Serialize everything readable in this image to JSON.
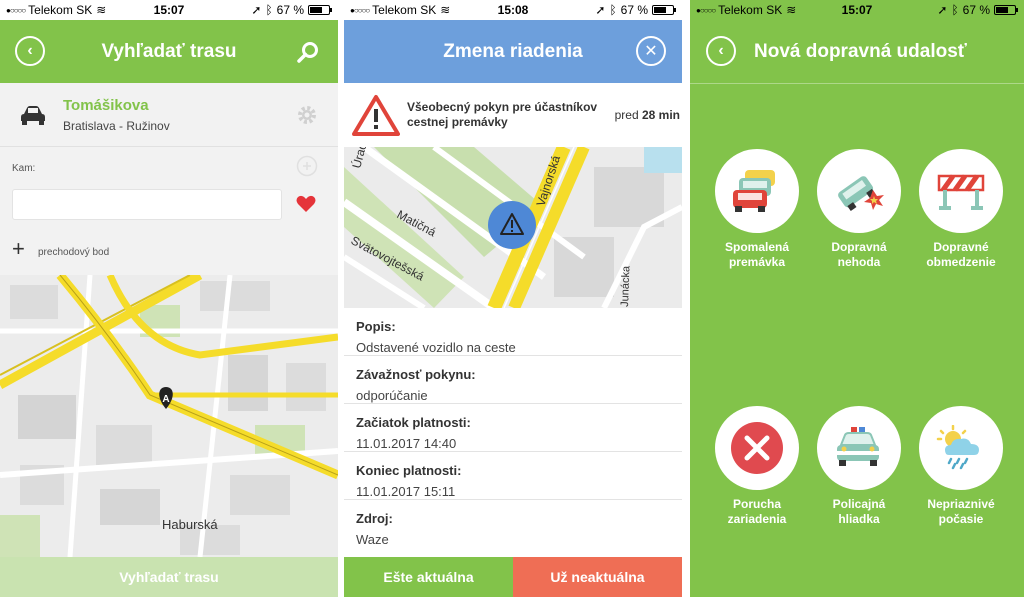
{
  "status": {
    "carrier": "Telekom SK",
    "battery": "67 %",
    "battery_level": 0.67,
    "time_screen1": "15:07",
    "time_screen2": "15:08",
    "time_screen3": "15:07"
  },
  "screen1": {
    "title": "Vyhľadať trasu",
    "origin": {
      "name": "Tomášikova",
      "address": "Bratislava - Ružinov"
    },
    "destination_label": "Kam:",
    "destination_value": "",
    "waypoint_label": "prechodový bod",
    "map_marker": "A",
    "map_street": "Haburská",
    "search_button": "Vyhľadať trasu"
  },
  "screen2": {
    "title": "Zmena riadenia",
    "alert_title": "Všeobecný pokyn pre účastníkov cestnej premávky",
    "ago_prefix": "pred",
    "ago_value": "28 min",
    "map_streets": [
      "Úradnícka",
      "Matičná",
      "Svätovojtešská",
      "Junácka",
      "Vajnorská"
    ],
    "details": [
      {
        "label": "Popis:",
        "value": "Odstavené vozidlo na ceste"
      },
      {
        "label": "Závažnosť pokynu:",
        "value": "odporúčanie"
      },
      {
        "label": "Začiatok platnosti:",
        "value": "11.01.2017 14:40"
      },
      {
        "label": "Koniec platnosti:",
        "value": "11.01.2017 15:11"
      },
      {
        "label": "Zdroj:",
        "value": "Waze"
      }
    ],
    "btn_still_valid": "Ešte aktuálna",
    "btn_not_valid": "Už neaktuálna"
  },
  "screen3": {
    "title": "Nová dopravná udalosť",
    "categories": [
      {
        "line1": "Spomalená",
        "line2": "premávka"
      },
      {
        "line1": "Dopravná",
        "line2": "nehoda"
      },
      {
        "line1": "Dopravné",
        "line2": "obmedzenie"
      },
      {
        "line1": "Porucha",
        "line2": "zariadenia"
      },
      {
        "line1": "Policajná",
        "line2": "hliadka"
      },
      {
        "line1": "Nepriaznivé",
        "line2": "počasie"
      }
    ]
  },
  "colors": {
    "green": "#82c34a",
    "blue": "#6d9fdc",
    "red_button": "#ef6e55",
    "green_button": "#82c34a",
    "light_green_button": "#c9e3b0",
    "heart": "#e5343a",
    "error_red": "#e04a4f"
  },
  "icons": [
    "back-icon",
    "search-icon",
    "car-icon",
    "gear-icon",
    "heart-icon",
    "plus-icon",
    "close-icon",
    "warning-icon",
    "map-pin-icon"
  ]
}
